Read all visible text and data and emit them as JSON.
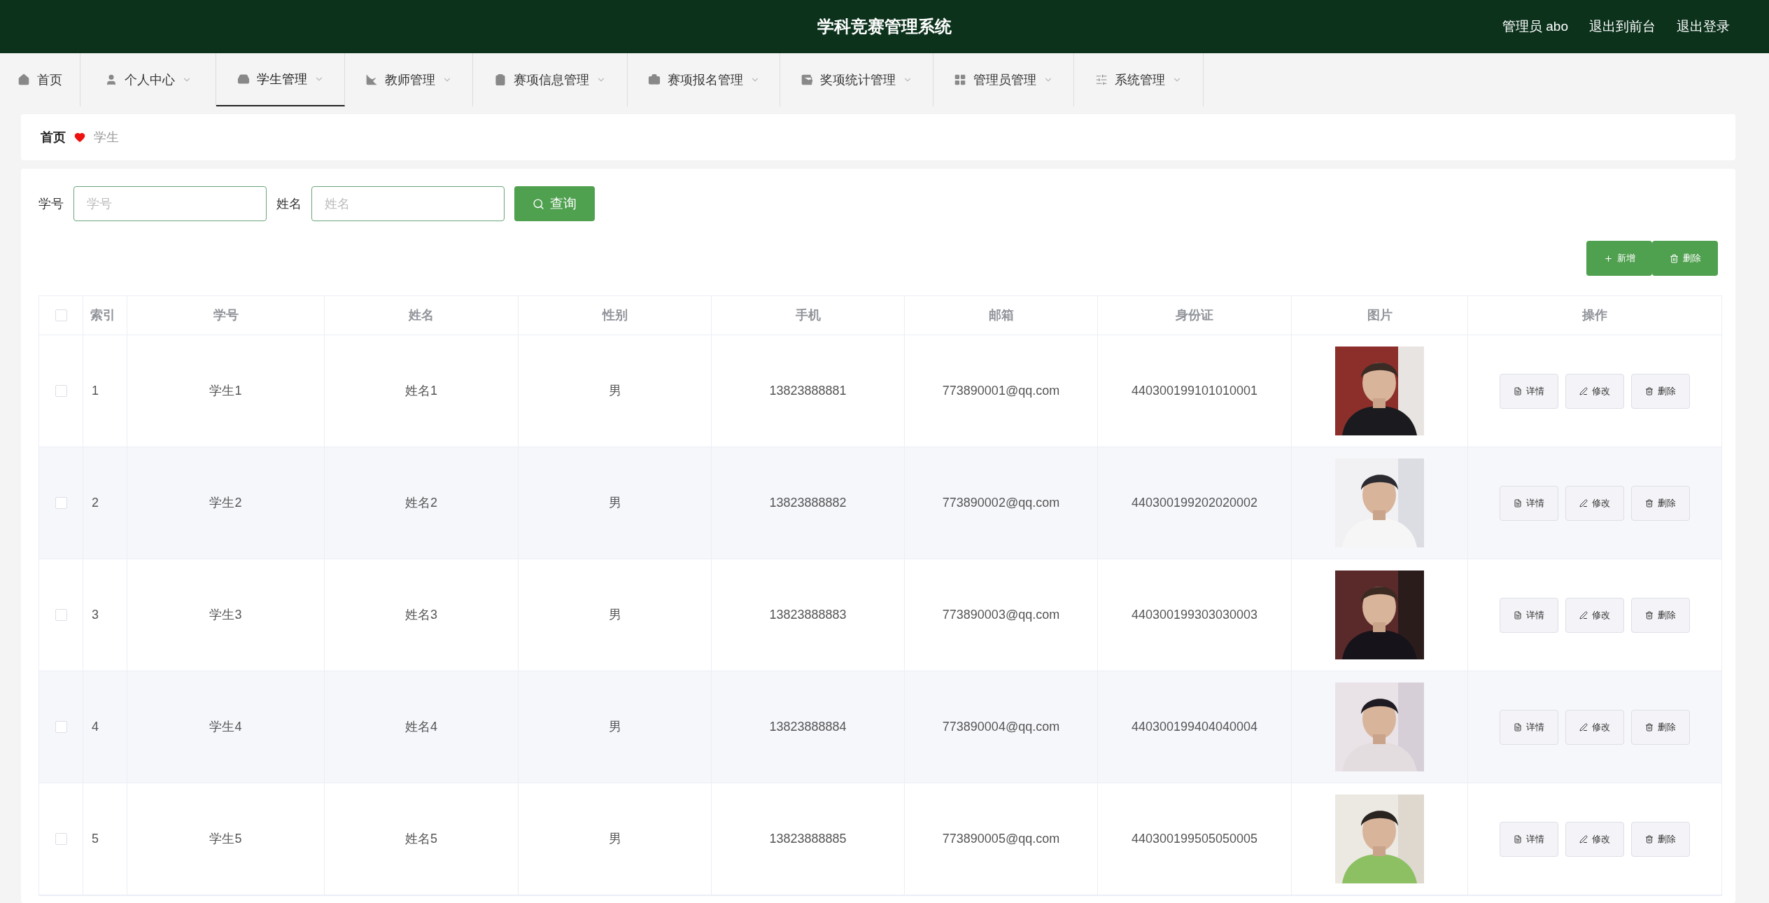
{
  "header": {
    "title": "学科竞赛管理系统",
    "links": [
      "管理员 abo",
      "退出到前台",
      "退出登录"
    ]
  },
  "nav": {
    "items": [
      {
        "label": "首页",
        "selected": false,
        "dropdown": false
      },
      {
        "label": "个人中心",
        "selected": false,
        "dropdown": true
      },
      {
        "label": "学生管理",
        "selected": true,
        "dropdown": true
      },
      {
        "label": "教师管理",
        "selected": false,
        "dropdown": true
      },
      {
        "label": "赛项信息管理",
        "selected": false,
        "dropdown": true
      },
      {
        "label": "赛项报名管理",
        "selected": false,
        "dropdown": true
      },
      {
        "label": "奖项统计管理",
        "selected": false,
        "dropdown": true
      },
      {
        "label": "管理员管理",
        "selected": false,
        "dropdown": true
      },
      {
        "label": "系统管理",
        "selected": false,
        "dropdown": true
      }
    ]
  },
  "breadcrumb": [
    "首页",
    "学生"
  ],
  "search": {
    "fields": [
      {
        "label": "学号",
        "placeholder": "学号"
      },
      {
        "label": "姓名",
        "placeholder": "姓名"
      }
    ],
    "button": "查询"
  },
  "toolbar": [
    {
      "kind": "add",
      "label": "新增"
    },
    {
      "kind": "delete",
      "label": "删除"
    }
  ],
  "table": {
    "select_all_checked": false,
    "columns": [
      "索引",
      "学号",
      "姓名",
      "性别",
      "手机",
      "邮箱",
      "身份证",
      "图片",
      "操作"
    ],
    "rows": [
      {
        "checked": false,
        "cells": [
          "1",
          "学生1",
          "姓名1",
          "男",
          "13823888881",
          "773890001@qq.com",
          "440300199101010001"
        ],
        "actions": [
          {
            "kind": "detail",
            "label": "详情"
          },
          {
            "kind": "edit",
            "label": "修改"
          },
          {
            "kind": "delete",
            "label": "删除"
          }
        ]
      },
      {
        "checked": false,
        "cells": [
          "2",
          "学生2",
          "姓名2",
          "男",
          "13823888882",
          "773890002@qq.com",
          "440300199202020002"
        ],
        "actions": [
          {
            "kind": "detail",
            "label": "详情"
          },
          {
            "kind": "edit",
            "label": "修改"
          },
          {
            "kind": "delete",
            "label": "删除"
          }
        ]
      },
      {
        "checked": false,
        "cells": [
          "3",
          "学生3",
          "姓名3",
          "男",
          "13823888883",
          "773890003@qq.com",
          "440300199303030003"
        ],
        "actions": [
          {
            "kind": "detail",
            "label": "详情"
          },
          {
            "kind": "edit",
            "label": "修改"
          },
          {
            "kind": "delete",
            "label": "删除"
          }
        ]
      },
      {
        "checked": false,
        "cells": [
          "4",
          "学生4",
          "姓名4",
          "男",
          "13823888884",
          "773890004@qq.com",
          "440300199404040004"
        ],
        "actions": [
          {
            "kind": "detail",
            "label": "详情"
          },
          {
            "kind": "edit",
            "label": "修改"
          },
          {
            "kind": "delete",
            "label": "删除"
          }
        ]
      },
      {
        "checked": false,
        "cells": [
          "5",
          "学生5",
          "姓名5",
          "男",
          "13823888885",
          "773890005@qq.com",
          "440300199505050005"
        ],
        "actions": [
          {
            "kind": "detail",
            "label": "详情"
          },
          {
            "kind": "edit",
            "label": "修改"
          },
          {
            "kind": "delete",
            "label": "删除"
          }
        ]
      }
    ]
  }
}
